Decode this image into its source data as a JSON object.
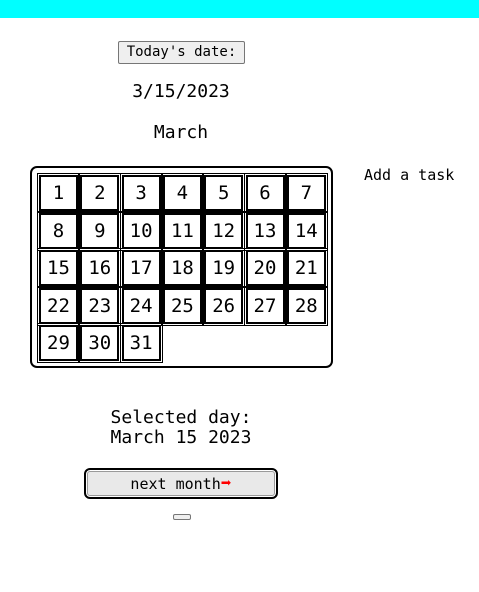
{
  "header": {
    "accent_color": "#00ffff"
  },
  "today_button": {
    "label": "Today's date:"
  },
  "current_date": "3/15/2023",
  "month_name": "March",
  "calendar": {
    "days": [
      "1",
      "2",
      "3",
      "4",
      "5",
      "6",
      "7",
      "8",
      "9",
      "10",
      "11",
      "12",
      "13",
      "14",
      "15",
      "16",
      "17",
      "18",
      "19",
      "20",
      "21",
      "22",
      "23",
      "24",
      "25",
      "26",
      "27",
      "28",
      "29",
      "30",
      "31"
    ]
  },
  "add_task": {
    "label": "Add a task"
  },
  "selected_day": {
    "label": "Selected day:",
    "value": "March 15 2023"
  },
  "next_button": {
    "label": "next month",
    "icon": "right-arrow-icon",
    "icon_glyph": "➡",
    "icon_color": "#ff0000"
  }
}
